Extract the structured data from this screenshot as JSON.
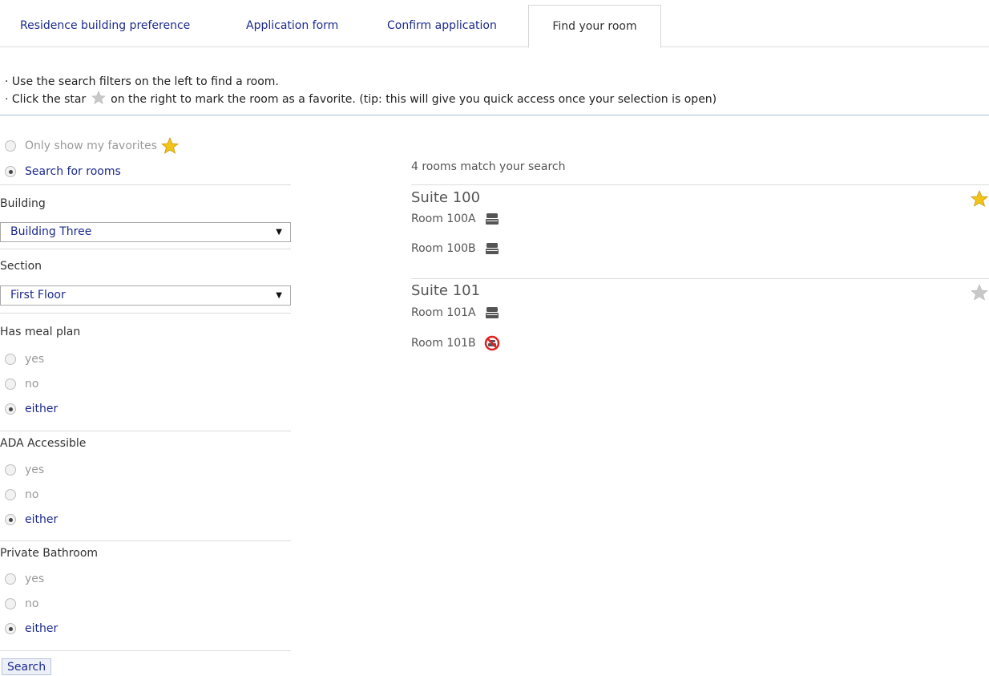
{
  "tabs": [
    {
      "label": "Residence building preference",
      "active": false
    },
    {
      "label": "Application form",
      "active": false
    },
    {
      "label": "Confirm application",
      "active": false
    },
    {
      "label": "Find your room",
      "active": true
    }
  ],
  "instructions": {
    "line1": "· Use the search filters on the left to find a room.",
    "line2_pre": "· Click the star",
    "line2_post": "on the right to mark the room as a favorite. (tip: this will give you quick access once your selection is open)"
  },
  "filters": {
    "only_favorites_label": "Only show my favorites",
    "search_rooms_label": "Search for rooms",
    "mode_selected": "search",
    "building": {
      "label": "Building",
      "value": "Building Three"
    },
    "section": {
      "label": "Section",
      "value": "First Floor"
    },
    "meal_plan": {
      "label": "Has meal plan",
      "options": [
        "yes",
        "no",
        "either"
      ],
      "selected": "either"
    },
    "ada": {
      "label": "ADA Accessible",
      "options": [
        "yes",
        "no",
        "either"
      ],
      "selected": "either"
    },
    "bathroom": {
      "label": "Private Bathroom",
      "options": [
        "yes",
        "no",
        "either"
      ],
      "selected": "either"
    },
    "search_button": "Search"
  },
  "results": {
    "count_text": "4 rooms match your search",
    "suites": [
      {
        "name": "Suite 100",
        "favorite": true,
        "rooms": [
          {
            "name": "Room 100A",
            "status": "available"
          },
          {
            "name": "Room 100B",
            "status": "available"
          }
        ]
      },
      {
        "name": "Suite 101",
        "favorite": false,
        "rooms": [
          {
            "name": "Room 101A",
            "status": "available"
          },
          {
            "name": "Room 101B",
            "status": "unavailable"
          }
        ]
      }
    ]
  },
  "icons": {
    "bed": "bed-icon",
    "unavailable": "bed-unavailable-icon",
    "star_on": "star-favorite-icon",
    "star_off": "star-empty-icon"
  },
  "colors": {
    "link": "#1b2a8c",
    "star_gold": "#f2c419",
    "star_gray": "#c8c8c8",
    "unavailable_red": "#e02020",
    "separator": "#a8c2dc"
  }
}
